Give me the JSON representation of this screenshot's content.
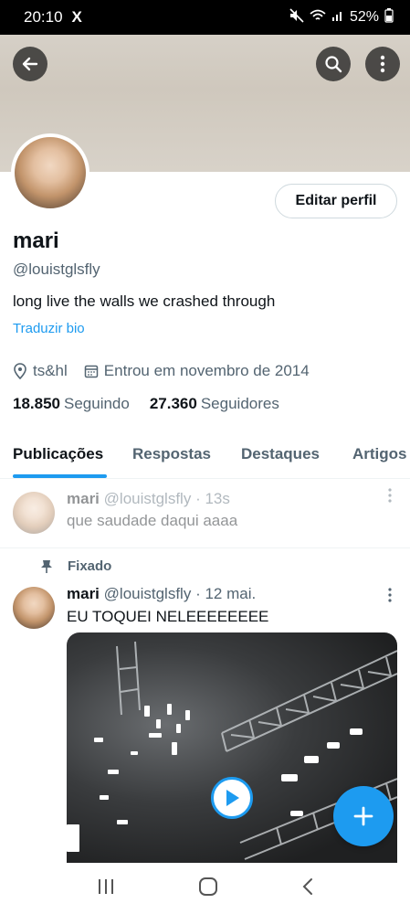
{
  "status_bar": {
    "time": "20:10",
    "app_icon": "X",
    "battery": "52%"
  },
  "profile": {
    "name": "mari",
    "handle": "@louistglsfly",
    "bio": "long live the walls we crashed through",
    "translate_label": "Traduzir bio",
    "location": "ts&hl",
    "joined": "Entrou em novembro de 2014",
    "following_count": "18.850",
    "following_label": "Seguindo",
    "followers_count": "27.360",
    "followers_label": "Seguidores",
    "edit_label": "Editar perfil"
  },
  "tabs": [
    {
      "label": "Publicações",
      "active": true
    },
    {
      "label": "Respostas",
      "active": false
    },
    {
      "label": "Destaques",
      "active": false
    },
    {
      "label": "Artigos",
      "active": false
    }
  ],
  "posts": [
    {
      "name": "mari",
      "handle": "@louistglsfly",
      "time": "· 13s",
      "text": "que saudade daqui aaaa",
      "pending": true
    },
    {
      "pinned_label": "Fixado",
      "name": "mari",
      "handle": "@louistglsfly",
      "time": "· 12 mai.",
      "text": "EU TOQUEI NELEEEEEEEE"
    }
  ],
  "colors": {
    "accent": "#1d9bf0",
    "text": "#0f1419",
    "secondary": "#536471"
  }
}
